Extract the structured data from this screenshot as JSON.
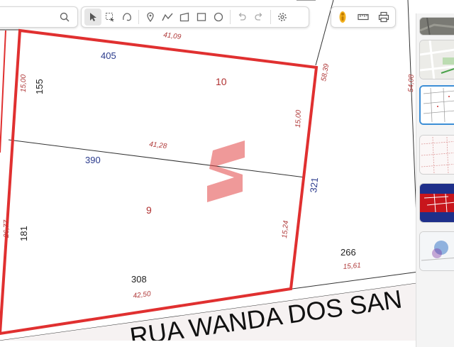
{
  "map": {
    "lot_numbers": [
      "405",
      "390",
      "155",
      "181",
      "308",
      "266",
      "321"
    ],
    "lot_labels": [
      "10",
      "9"
    ],
    "measurements": [
      "41,09",
      "15,00",
      "58,39",
      "15,00",
      "41,28",
      "54,08",
      "26,77",
      "15,24",
      "42,50",
      "15,61"
    ],
    "street_name": "RUA WANDA DOS SAN",
    "colors": {
      "lot_number": "#2a3a8c",
      "lot_label": "#b03030",
      "measurement": "#b03a3a",
      "highlight_border": "#e03030",
      "parcel_line": "#333333",
      "street_band": "#f6f2f2",
      "watermark": "#e14545"
    }
  },
  "toolbar_left": {
    "icons": [
      "search-icon",
      "pointer-icon",
      "box-select-icon",
      "lasso-icon",
      "pin-icon",
      "polyline-icon",
      "polygon-icon",
      "rectangle-icon",
      "circle-icon",
      "undo-icon",
      "redo-icon",
      "gear-icon"
    ]
  },
  "toolbar_right": {
    "icons": [
      "street-view-icon",
      "ruler-icon",
      "print-icon"
    ]
  },
  "side_panel": {
    "thumbnails": [
      "satellite",
      "streets",
      "cadastre",
      "parcels",
      "zoning",
      "density"
    ]
  }
}
